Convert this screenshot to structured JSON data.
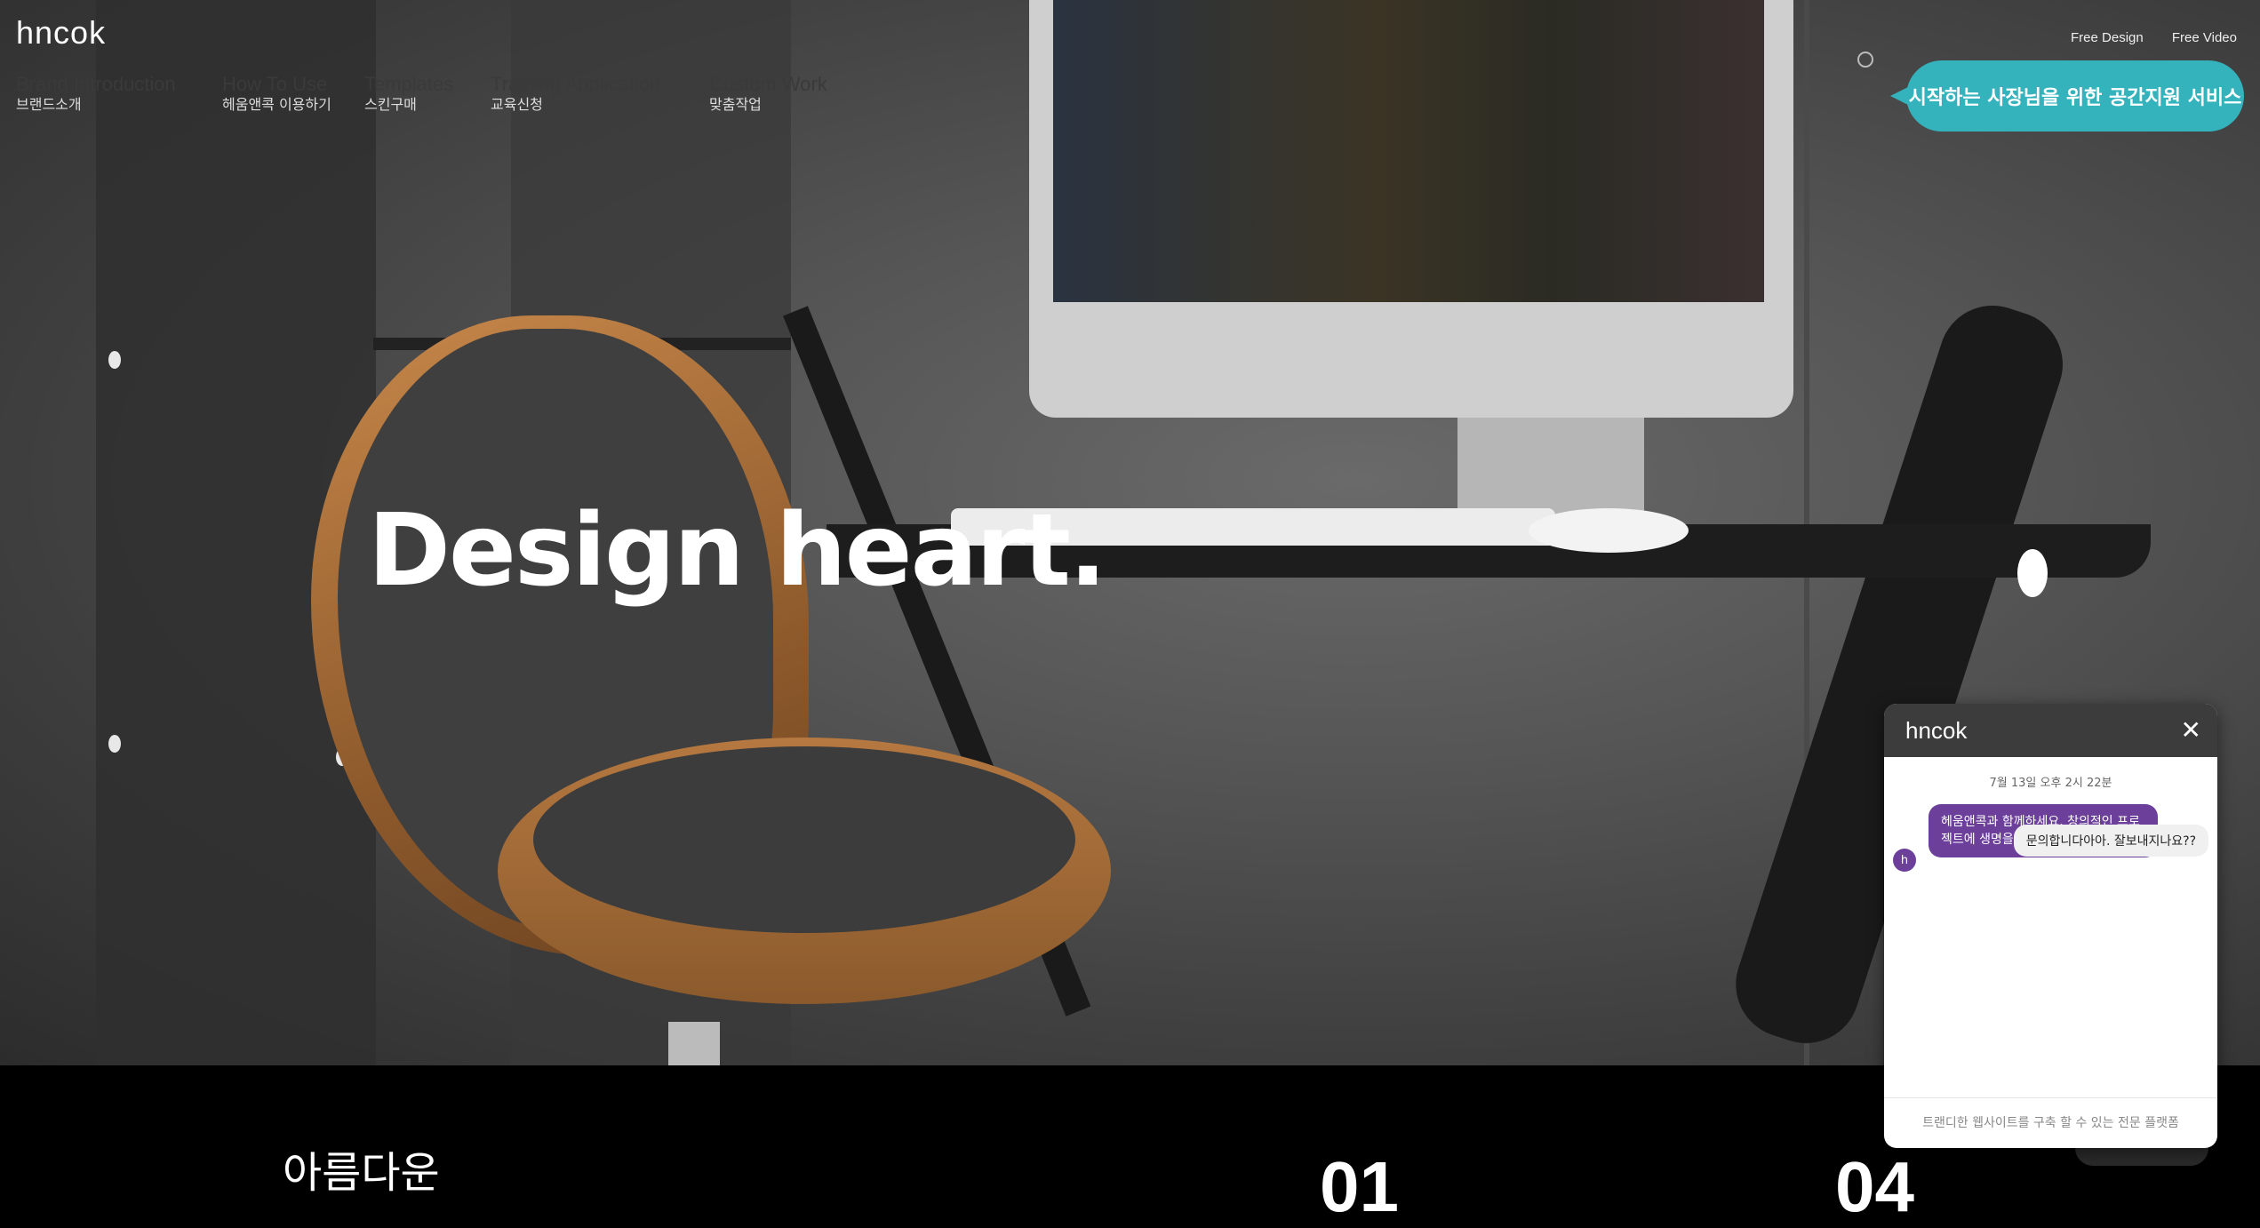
{
  "brand": {
    "logo": "hncok"
  },
  "nav": [
    {
      "en": "Brand Introduction",
      "ko": "브랜드소개"
    },
    {
      "en": "How To Use",
      "ko": "헤움앤콕 이용하기"
    },
    {
      "en": "Templates",
      "ko": "스킨구매"
    },
    {
      "en": "Training Application",
      "ko": "교육신청"
    },
    {
      "en": "Custom Work",
      "ko": "맞춤작업"
    }
  ],
  "top_links": {
    "free_design": "Free Design",
    "free_video": "Free Video"
  },
  "cta": {
    "label": "시작하는 사장님을 위한 공간지원 서비스"
  },
  "hero": {
    "title": "Design heart."
  },
  "bottom": {
    "heading": "아름다운",
    "num_left": "01",
    "num_right": "04"
  },
  "chat": {
    "logo": "hncok",
    "close": "✕",
    "date": "7월 13일 오후 2시 22분",
    "avatar": "h",
    "bot_message": "헤움앤콕과 함께하세요. 창의적인 프로젝트에 생명을 불어 넣을 수 있습니다.",
    "user_message": "문의합니다아아. 잘보내지나요??",
    "input_placeholder": "트랜디한 웹사이트를 구축 할 수 있는 전문 플랫폼"
  },
  "colors": {
    "accent": "#35b3bd",
    "chat_purple": "#6b3f9a",
    "chat_header": "#3c3c3c"
  }
}
